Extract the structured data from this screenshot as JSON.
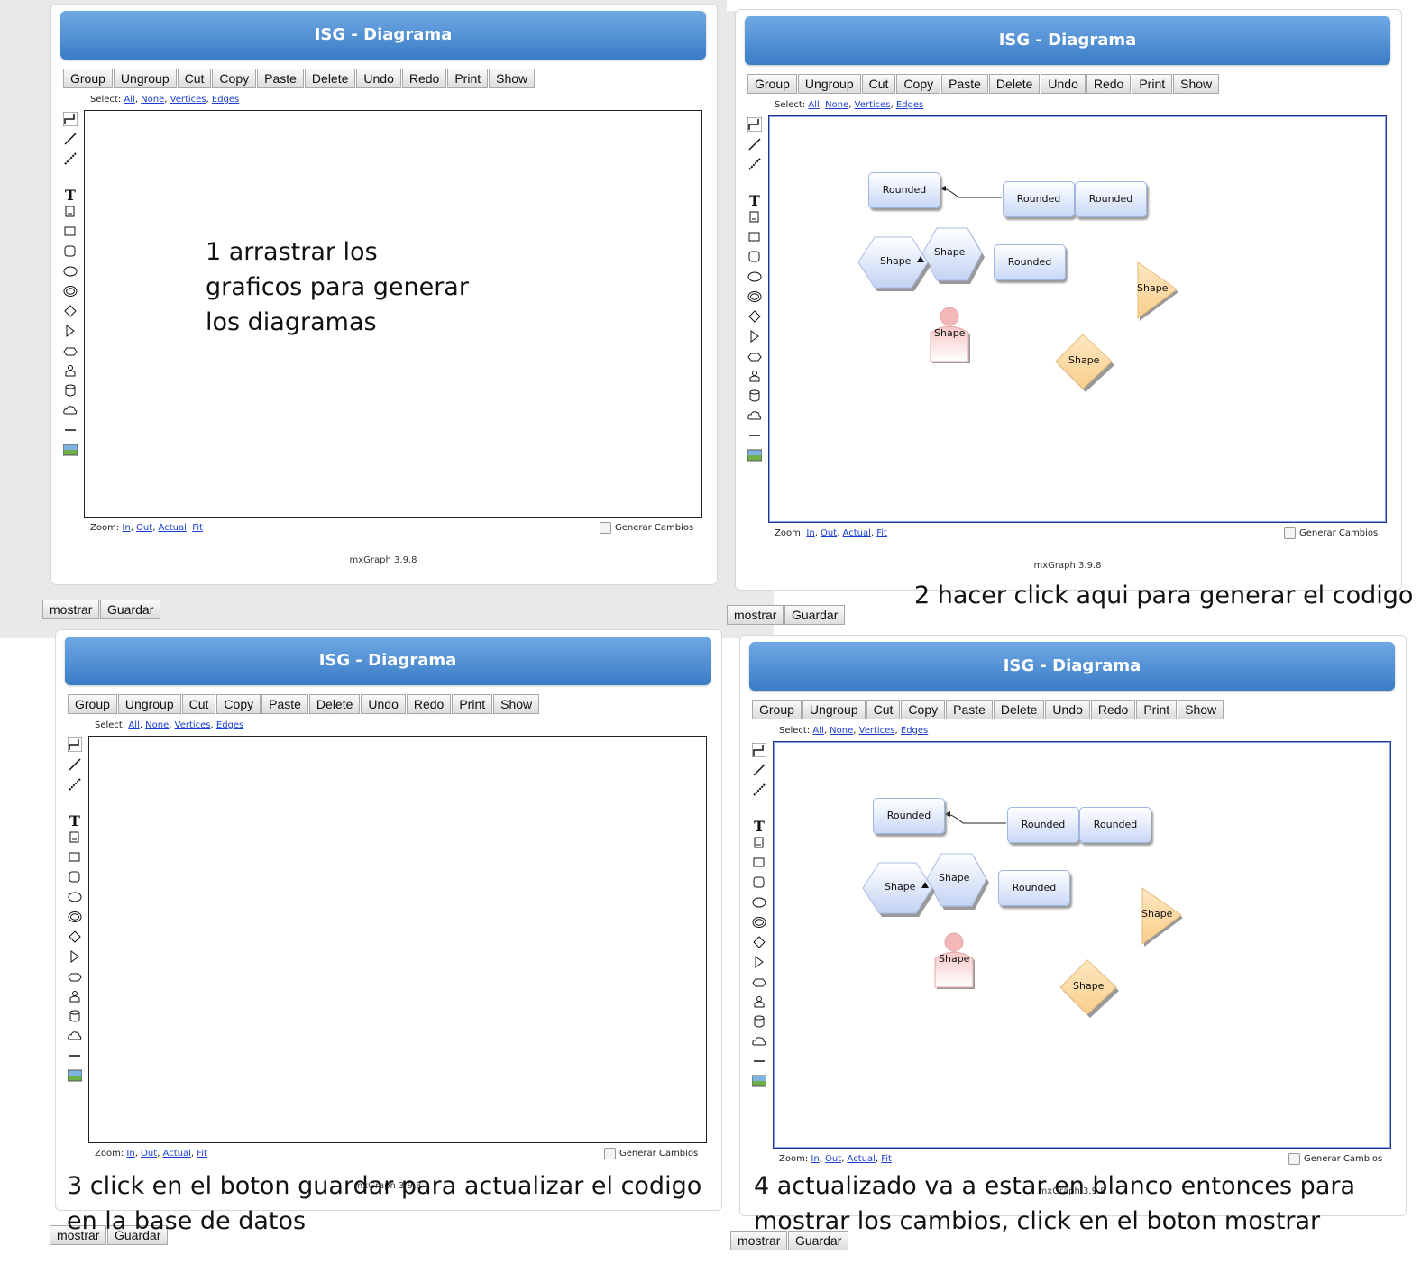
{
  "app": {
    "title": "ISG - Diagrama",
    "toolbar": [
      "Group",
      "Ungroup",
      "Cut",
      "Copy",
      "Paste",
      "Delete",
      "Undo",
      "Redo",
      "Print",
      "Show"
    ],
    "select": {
      "prefix": "Select:",
      "links": [
        "All",
        "None",
        "Vertices",
        "Edges"
      ]
    },
    "zoom": {
      "prefix": "Zoom:",
      "links": [
        "In",
        "Out",
        "Actual",
        "Fit"
      ]
    },
    "generar": "Generar Cambios",
    "version": "mxGraph 3.9.8",
    "buttons": {
      "mostrar": "mostrar",
      "guardar": "Guardar"
    },
    "palette": [
      "connector-icon",
      "line-icon",
      "dashed-line-icon",
      "text-icon",
      "label-icon",
      "rectangle-icon",
      "rounded-rect-icon",
      "ellipse-icon",
      "double-ellipse-icon",
      "rhombus-icon",
      "triangle-icon",
      "hexagon-icon",
      "actor-icon",
      "cylinder-icon",
      "cloud-icon",
      "hline-icon",
      "image-icon"
    ]
  },
  "diagram": {
    "rounded_label": "Rounded",
    "shape_label": "Shape"
  },
  "notes": {
    "step1": [
      "1 arrastrar los",
      "graficos para generar",
      "los diagramas"
    ],
    "step2": "2 hacer click aqui para generar el codigo",
    "step3": [
      "3 click en el boton guardar para actualizar el codigo",
      "en la base de datos"
    ],
    "step4": [
      "4 actualizado va a estar en blanco entonces para",
      "mostrar los cambios, click en el boton mostrar"
    ]
  },
  "colors": {
    "title_gradient_top": "#6fa9e4",
    "title_gradient_bottom": "#3a7cc6",
    "rounded_fill": "#c9d8f7",
    "hexagon_fill": "#c3d3f3",
    "actor_fill": "#f6c6c6",
    "rhombus_fill": "#f9cf8c",
    "link": "#1a3fd0"
  }
}
